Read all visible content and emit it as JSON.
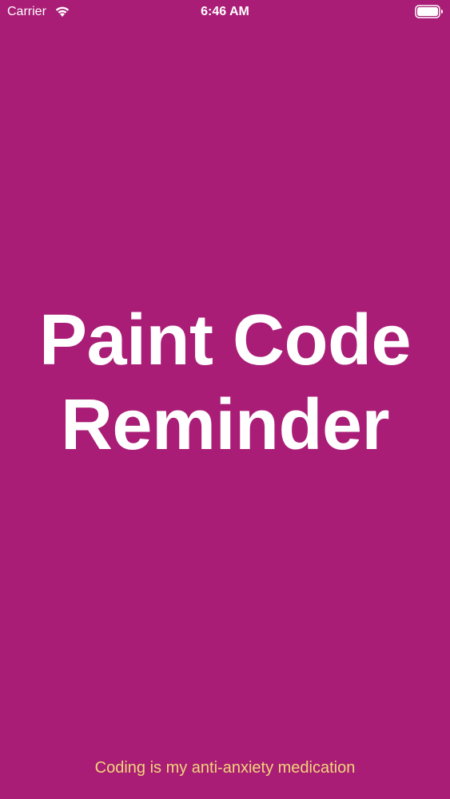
{
  "status_bar": {
    "carrier": "Carrier",
    "time": "6:46 AM",
    "wifi_icon": "wifi-icon",
    "battery_icon": "battery-icon"
  },
  "main": {
    "title_line_1": "Paint Code",
    "title_line_2": "Reminder",
    "tagline": "Coding is my anti-anxiety medication"
  },
  "colors": {
    "background": "#a91d76",
    "title": "#ffffff",
    "tagline": "#f2d47a"
  }
}
